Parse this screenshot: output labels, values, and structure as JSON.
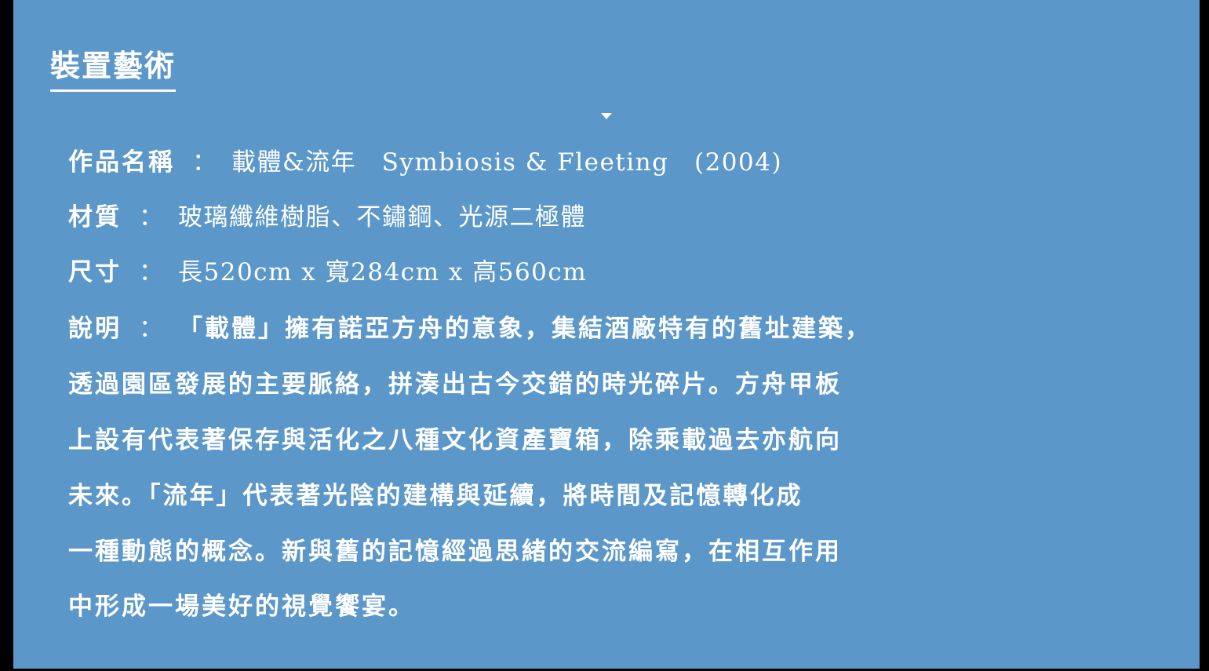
{
  "slide": {
    "title": "裝置藝術",
    "work": {
      "label": "作品名稱",
      "separator": "：",
      "value": "載體&流年　Symbiosis & Fleeting　(2004)"
    },
    "material": {
      "label": "材質",
      "separator": "：",
      "value": "玻璃纖維樹脂、不鏽鋼、光源二極體"
    },
    "size": {
      "label": "尺寸",
      "separator": "：",
      "value": "長520cm x 寬284cm x 高560cm"
    },
    "description": {
      "label": "說明",
      "separator": "：",
      "lines": [
        "「載體」擁有諾亞方舟的意象，集結酒廠特有的舊址建築，",
        "透過園區發展的主要脈絡，拼湊出古今交錯的時光碎片。方舟甲板",
        "上設有代表著保存與活化之八種文化資產寶箱，除乘載過去亦航向",
        "未來。「流年」代表著光陰的建構與延續，將時間及記憶轉化成",
        "一種動態的概念。新與舊的記憶經過思緒的交流編寫，在相互作用",
        "中形成一場美好的視覺饗宴。"
      ]
    }
  },
  "colors": {
    "background": "#5b97c9",
    "text": "#ffffff",
    "frame": "#000000"
  }
}
